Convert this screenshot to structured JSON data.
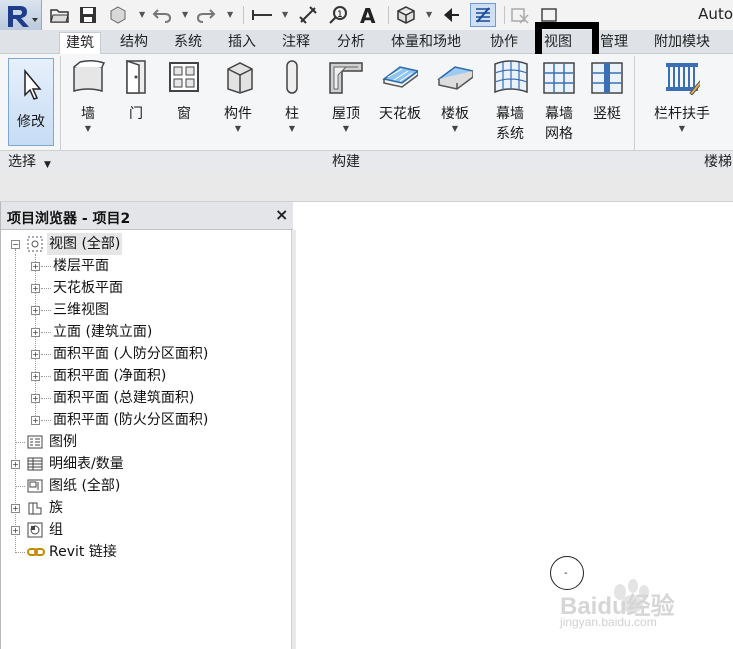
{
  "app": {
    "title": "Auto",
    "logo_letter": "R"
  },
  "quick_access": [
    {
      "name": "open-icon"
    },
    {
      "name": "save-icon"
    },
    {
      "name": "sync-icon"
    },
    {
      "name": "undo-icon"
    },
    {
      "name": "redo-icon"
    },
    {
      "name": "measure-icon"
    },
    {
      "name": "align-dimension-icon"
    },
    {
      "name": "tag-icon"
    },
    {
      "name": "text-icon"
    },
    {
      "name": "3d-view-icon"
    },
    {
      "name": "section-icon"
    },
    {
      "name": "thin-lines-icon"
    },
    {
      "name": "close-hidden-icon"
    },
    {
      "name": "switch-windows-icon"
    }
  ],
  "tabs": [
    {
      "label": "建筑",
      "active": true
    },
    {
      "label": "结构"
    },
    {
      "label": "系统"
    },
    {
      "label": "插入"
    },
    {
      "label": "注释"
    },
    {
      "label": "分析"
    },
    {
      "label": "体量和场地"
    },
    {
      "label": "协作"
    },
    {
      "label": "视图",
      "highlighted": true
    },
    {
      "label": "管理"
    },
    {
      "label": "附加模块"
    }
  ],
  "ribbon": {
    "modify_label": "修改",
    "buttons": [
      {
        "label": "墙",
        "icon": "wall-icon",
        "dropdown": true
      },
      {
        "label": "门",
        "icon": "door-icon"
      },
      {
        "label": "窗",
        "icon": "window-icon"
      },
      {
        "label": "构件",
        "icon": "component-icon",
        "dropdown": true
      },
      {
        "label": "柱",
        "icon": "column-icon",
        "dropdown": true
      },
      {
        "label": "屋顶",
        "icon": "roof-icon",
        "dropdown": true
      },
      {
        "label": "天花板",
        "icon": "ceiling-icon"
      },
      {
        "label": "楼板",
        "icon": "floor-icon",
        "dropdown": true
      },
      {
        "label": "幕墙",
        "label2": "系统",
        "icon": "curtain-system-icon"
      },
      {
        "label": "幕墙",
        "label2": "网格",
        "icon": "curtain-grid-icon"
      },
      {
        "label": "竖梃",
        "icon": "mullion-icon"
      },
      {
        "label": "栏杆扶手",
        "icon": "railing-icon",
        "dropdown": true
      }
    ],
    "panels": {
      "select": "选择",
      "build": "构建",
      "stairs": "楼梯"
    }
  },
  "browser": {
    "title": "项目浏览器 - 项目2",
    "close": "×",
    "nodes": [
      {
        "label": "视图 (全部)",
        "level": 0,
        "expander": "−",
        "icon": "views-icon",
        "selected": true
      },
      {
        "label": "楼层平面",
        "level": 1,
        "expander": "+"
      },
      {
        "label": "天花板平面",
        "level": 1,
        "expander": "+"
      },
      {
        "label": "三维视图",
        "level": 1,
        "expander": "+"
      },
      {
        "label": "立面 (建筑立面)",
        "level": 1,
        "expander": "+"
      },
      {
        "label": "面积平面 (人防分区面积)",
        "level": 1,
        "expander": "+"
      },
      {
        "label": "面积平面 (净面积)",
        "level": 1,
        "expander": "+"
      },
      {
        "label": "面积平面 (总建筑面积)",
        "level": 1,
        "expander": "+"
      },
      {
        "label": "面积平面 (防火分区面积)",
        "level": 1,
        "expander": "+"
      },
      {
        "label": "图例",
        "level": 0,
        "icon": "legend-icon"
      },
      {
        "label": "明细表/数量",
        "level": 0,
        "expander": "+",
        "icon": "schedule-icon"
      },
      {
        "label": "图纸 (全部)",
        "level": 0,
        "icon": "sheet-icon"
      },
      {
        "label": "族",
        "level": 0,
        "expander": "+",
        "icon": "family-icon"
      },
      {
        "label": "组",
        "level": 0,
        "expander": "+",
        "icon": "group-icon"
      },
      {
        "label": "Revit 链接",
        "level": 0,
        "icon": "link-icon"
      }
    ]
  },
  "watermark": {
    "brand": "Baidu经验",
    "url": "jingyan.baidu.com"
  }
}
